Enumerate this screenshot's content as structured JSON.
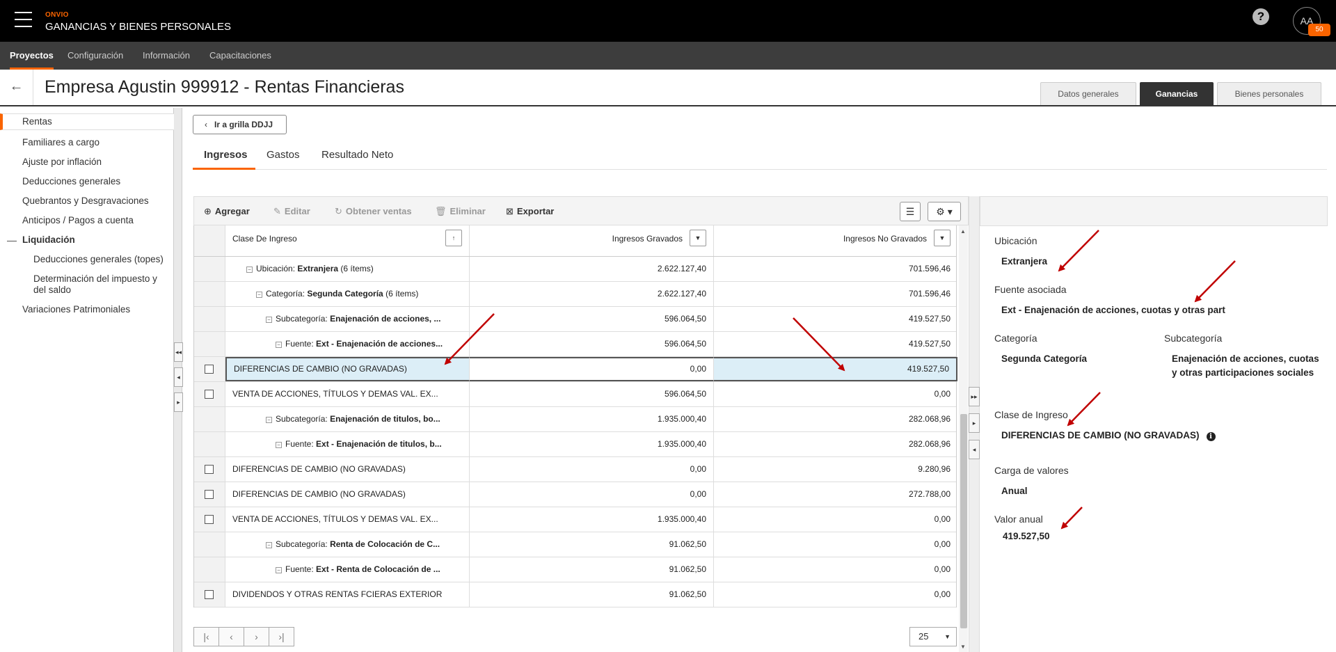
{
  "header": {
    "brand": "ONVIO",
    "app_title": "GANANCIAS Y BIENES PERSONALES",
    "help_label": "?",
    "avatar_initials": "AA",
    "notification_count": "50"
  },
  "nav": {
    "items": [
      {
        "label": "Proyectos",
        "active": true
      },
      {
        "label": "Configuración"
      },
      {
        "label": "Información"
      },
      {
        "label": "Capacitaciones"
      }
    ]
  },
  "page": {
    "back_icon": "←",
    "title": "Empresa Agustin 999912 - Rentas Financieras",
    "top_tabs": [
      {
        "label": "Datos generales"
      },
      {
        "label": "Ganancias",
        "active": true
      },
      {
        "label": "Bienes personales"
      }
    ]
  },
  "sidebar": {
    "items": [
      {
        "label": "Rentas",
        "active": true
      },
      {
        "label": "Familiares a cargo"
      },
      {
        "label": "Ajuste por inflación"
      },
      {
        "label": "Deducciones generales"
      },
      {
        "label": "Quebrantos y Desgravaciones"
      },
      {
        "label": "Anticipos / Pagos a cuenta"
      },
      {
        "label": "Liquidación",
        "group": true
      },
      {
        "label": "Deducciones generales (topes)"
      },
      {
        "label": "Determinación del impuesto y del saldo"
      },
      {
        "label": "Variaciones Patrimoniales"
      }
    ]
  },
  "content": {
    "back_grid_label": "Ir a grilla DDJJ",
    "sub_tabs": [
      {
        "label": "Ingresos",
        "active": true
      },
      {
        "label": "Gastos"
      },
      {
        "label": "Resultado Neto"
      }
    ],
    "toolbar": {
      "add": "Agregar",
      "edit": "Editar",
      "sales": "Obtener ventas",
      "delete": "Eliminar",
      "export": "Exportar"
    },
    "grid": {
      "columns": [
        "Clase De Ingreso",
        "Ingresos Gravados",
        "Ingresos No Gravados"
      ],
      "rows": [
        {
          "indent": 1,
          "prefix": "Ubicación: ",
          "bold": "Extranjera",
          "suffix": " (6 ítems)",
          "gravados": "2.622.127,40",
          "no_gravados": "701.596,46"
        },
        {
          "indent": 2,
          "prefix": "Categoría: ",
          "bold": "Segunda Categoría",
          "suffix": " (6 ítems)",
          "gravados": "2.622.127,40",
          "no_gravados": "701.596,46"
        },
        {
          "indent": 3,
          "prefix": "Subcategoría: ",
          "bold": "Enajenación de acciones, ...",
          "suffix": "",
          "gravados": "596.064,50",
          "no_gravados": "419.527,50"
        },
        {
          "indent": 4,
          "prefix": "Fuente: ",
          "bold": "Ext - Enajenación de acciones...",
          "suffix": "",
          "gravados": "596.064,50",
          "no_gravados": "419.527,50"
        },
        {
          "checkbox": true,
          "selected": true,
          "text": "DIFERENCIAS DE CAMBIO (NO GRAVADAS)",
          "gravados": "0,00",
          "no_gravados": "419.527,50"
        },
        {
          "checkbox": true,
          "text": "VENTA DE ACCIONES, TÍTULOS Y DEMAS VAL. EX...",
          "gravados": "596.064,50",
          "no_gravados": "0,00"
        },
        {
          "indent": 3,
          "prefix": "Subcategoría: ",
          "bold": "Enajenación de titulos, bo...",
          "suffix": "",
          "gravados": "1.935.000,40",
          "no_gravados": "282.068,96"
        },
        {
          "indent": 4,
          "prefix": "Fuente: ",
          "bold": "Ext - Enajenación de titulos, b...",
          "suffix": "",
          "gravados": "1.935.000,40",
          "no_gravados": "282.068,96"
        },
        {
          "checkbox": true,
          "text": "DIFERENCIAS DE CAMBIO (NO GRAVADAS)",
          "gravados": "0,00",
          "no_gravados": "9.280,96"
        },
        {
          "checkbox": true,
          "text": "DIFERENCIAS DE CAMBIO (NO GRAVADAS)",
          "gravados": "0,00",
          "no_gravados": "272.788,00"
        },
        {
          "checkbox": true,
          "text": "VENTA DE ACCIONES, TÍTULOS Y DEMAS VAL. EX...",
          "gravados": "1.935.000,40",
          "no_gravados": "0,00"
        },
        {
          "indent": 3,
          "prefix": "Subcategoría: ",
          "bold": "Renta de Colocación de C...",
          "suffix": "",
          "gravados": "91.062,50",
          "no_gravados": "0,00"
        },
        {
          "indent": 4,
          "prefix": "Fuente: ",
          "bold": "Ext - Renta de Colocación de ...",
          "suffix": "",
          "gravados": "91.062,50",
          "no_gravados": "0,00"
        },
        {
          "checkbox": true,
          "text": "DIVIDENDOS Y OTRAS RENTAS FCIERAS EXTERIOR",
          "gravados": "91.062,50",
          "no_gravados": "0,00"
        }
      ]
    },
    "pager": {
      "page_size": "25"
    }
  },
  "detail": {
    "ubicacion_label": "Ubicación",
    "ubicacion_value": "Extranjera",
    "fuente_label": "Fuente asociada",
    "fuente_value": "Ext - Enajenación de acciones, cuotas y otras part",
    "categoria_label": "Categoría",
    "categoria_value": "Segunda Categoría",
    "subcategoria_label": "Subcategoría",
    "subcategoria_value": "Enajenación de acciones, cuotas y otras participaciones sociales",
    "clase_label": "Clase de Ingreso",
    "clase_value": "DIFERENCIAS DE CAMBIO (NO GRAVADAS)",
    "carga_label": "Carga de valores",
    "carga_value": "Anual",
    "valor_label": "Valor anual",
    "valor_value": "419.527,50"
  },
  "colors": {
    "accent": "#fa6400",
    "arrow": "#c00000",
    "selection": "#dceef7"
  }
}
